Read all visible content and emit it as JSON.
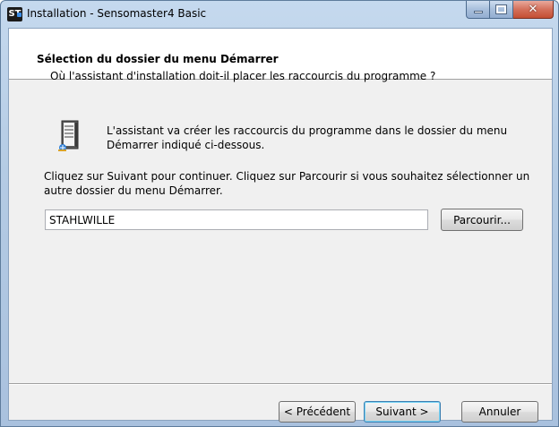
{
  "window": {
    "title": "Installation - Sensomaster4 Basic",
    "app_icon_label": "ST"
  },
  "header": {
    "title": "Sélection du dossier du menu Démarrer",
    "subtitle": "Où l'assistant d'installation doit-il placer les raccourcis du programme ?"
  },
  "body": {
    "info_text": "L'assistant va créer les raccourcis du programme dans le dossier du menu Démarrer indiqué ci-dessous.",
    "instruction_text": "Cliquez sur Suivant pour continuer. Cliquez sur Parcourir si vous souhaitez sélectionner un autre dossier du menu Démarrer.",
    "folder_value": "STAHLWILLE",
    "browse_label": "Parcourir..."
  },
  "footer": {
    "back_label": "< Précédent",
    "next_label": "Suivant >",
    "cancel_label": "Annuler"
  },
  "icons": {
    "app": "app-logo-icon",
    "info": "start-menu-folder-icon",
    "minimize": "minimize-icon",
    "maximize": "maximize-icon",
    "close": "close-icon"
  },
  "colors": {
    "titlebar": "#b4cbe4",
    "close_button": "#c44e33",
    "default_button_border": "#3c7fb1"
  }
}
